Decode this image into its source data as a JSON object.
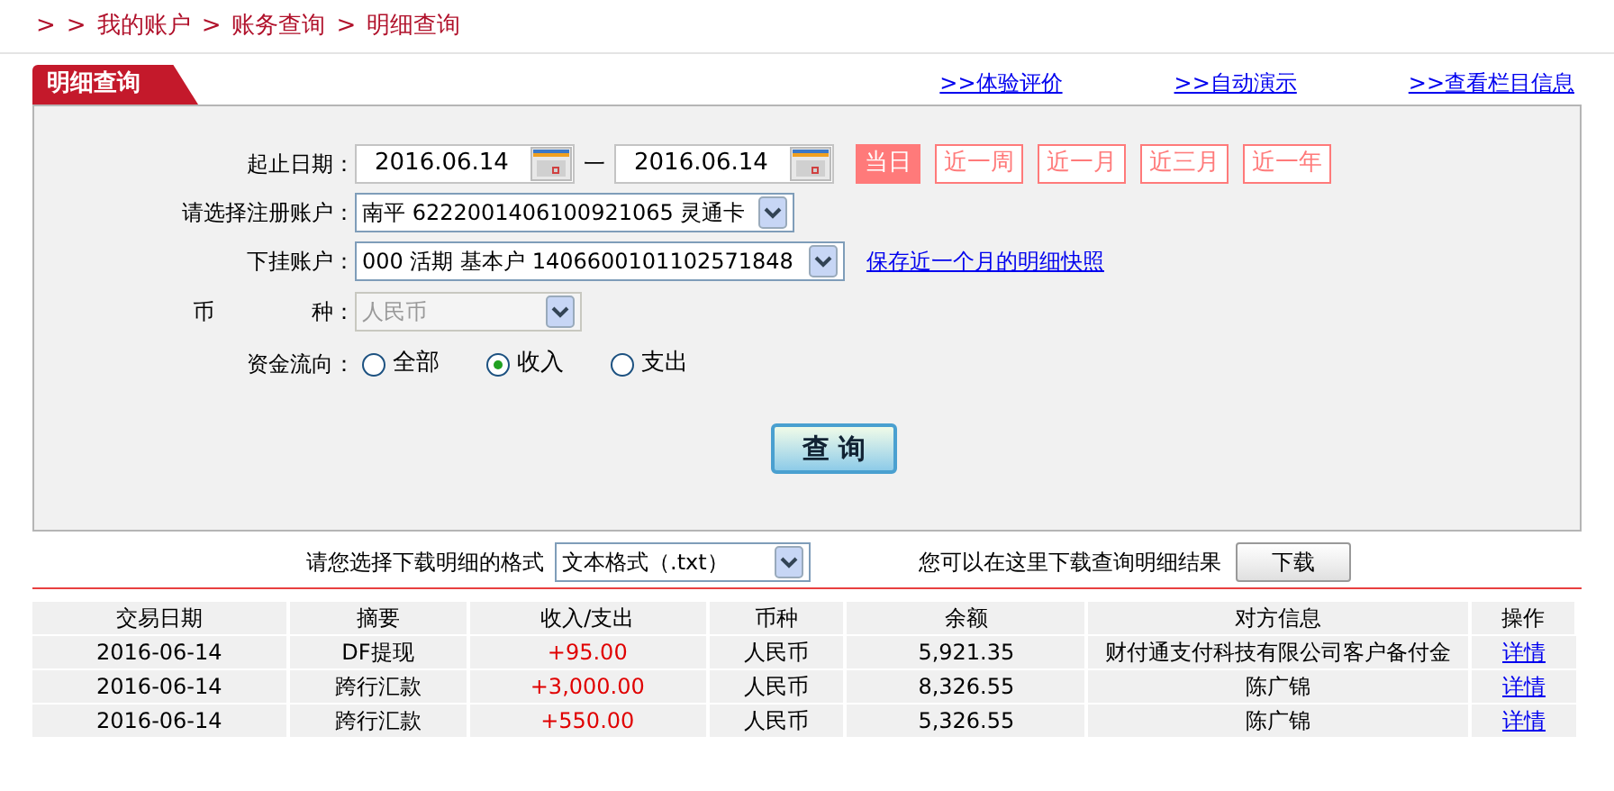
{
  "breadcrumb": [
    "我的账户",
    "账务查询",
    "明细查询"
  ],
  "breadcrumb_sep": ">",
  "panel_title": "明细查询",
  "header_links": [
    ">>体验评价",
    ">>自动演示",
    ">>查看栏目信息"
  ],
  "form": {
    "date_label": "起止日期：",
    "date_from": "2016.06.14",
    "date_sep": "一",
    "date_to": "2016.06.14",
    "ranges": [
      {
        "label": "当日",
        "selected": true
      },
      {
        "label": "近一周",
        "selected": false
      },
      {
        "label": "近一月",
        "selected": false
      },
      {
        "label": "近三月",
        "selected": false
      },
      {
        "label": "近一年",
        "selected": false
      }
    ],
    "account_label": "请选择注册账户：",
    "account_value": "南平  6222001406100921065 灵通卡",
    "sub_label": "下挂账户：",
    "sub_value": "000 活期 基本户 1406600101102571848",
    "snapshot_link": "保存近一个月的明细快照",
    "currency_label_1": "币",
    "currency_label_2": "种：",
    "currency_value": "人民币",
    "currency_disabled": true,
    "flow_label": "资金流向：",
    "flows": [
      {
        "label": "全部",
        "selected": false
      },
      {
        "label": "收入",
        "selected": true
      },
      {
        "label": "支出",
        "selected": false
      }
    ],
    "query_button": "查 询"
  },
  "download": {
    "format_label": "请您选择下载明细的格式",
    "format_value": "文本格式（.txt）",
    "hint": "您可以在这里下载查询明细结果",
    "button": "下载"
  },
  "table": {
    "columns": [
      "交易日期",
      "摘要",
      "收入/支出",
      "币种",
      "余额",
      "对方信息",
      "操作"
    ],
    "rows": [
      [
        "2016-06-14",
        "DF提现",
        "+95.00",
        "人民币",
        "5,921.35",
        "财付通支付科技有限公司客户备付金",
        "详情"
      ],
      [
        "2016-06-14",
        "跨行汇款",
        "+3,000.00",
        "人民币",
        "8,326.55",
        "陈广锦",
        "详情"
      ],
      [
        "2016-06-14",
        "跨行汇款",
        "+550.00",
        "人民币",
        "5,326.55",
        "陈广锦",
        "详情"
      ]
    ]
  }
}
